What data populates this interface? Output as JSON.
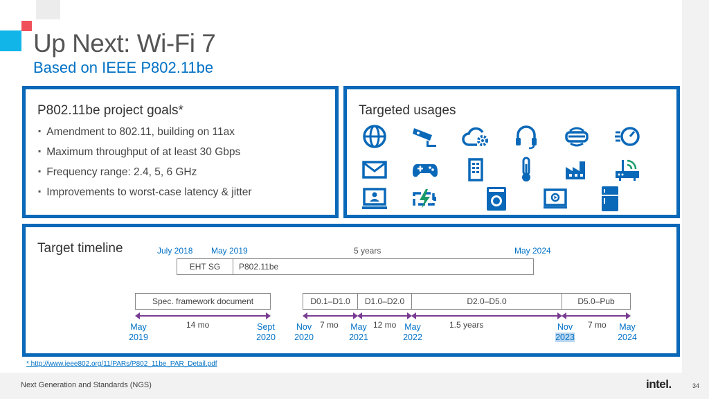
{
  "slide": {
    "title": "Up Next: Wi-Fi 7",
    "subtitle": "Based on IEEE P802.11be"
  },
  "goals": {
    "heading": "P802.11be project goals*",
    "items": [
      "Amendment to 802.11, building on 11ax",
      "Maximum throughput of at least 30 Gbps",
      "Frequency range: 2.4, 5, 6 GHz",
      "Improvements to worst-case latency & jitter"
    ]
  },
  "usages": {
    "heading": "Targeted usages",
    "icons": [
      "globe-icon",
      "security-camera-icon",
      "cloud-settings-icon",
      "headset-icon",
      "vr-headset-icon",
      "speedometer-icon",
      "mail-icon",
      "gamepad-icon",
      "smart-panel-icon",
      "thermometer-icon",
      "factory-icon",
      "router-icon",
      "video-call-icon",
      "battery-charging-icon",
      "washing-machine-icon",
      "monitor-play-icon",
      "refrigerator-icon"
    ]
  },
  "timeline": {
    "heading": "Target timeline",
    "top_labels": {
      "start": "July 2018",
      "mid": "May 2019",
      "span": "5 years",
      "end": "May 2024"
    },
    "top_bars": [
      "EHT SG",
      "P802.11be"
    ],
    "phases": [
      "Spec. framework document",
      "D0.1–D1.0",
      "D1.0–D2.0",
      "D2.0–D5.0",
      "D5.0–Pub"
    ],
    "durations": [
      "14 mo",
      "7 mo",
      "12 mo",
      "1.5 years",
      "7 mo"
    ],
    "dates": [
      {
        "m": "May",
        "y": "2019"
      },
      {
        "m": "Sept",
        "y": "2020"
      },
      {
        "m": "Nov",
        "y": "2020"
      },
      {
        "m": "May",
        "y": "2021"
      },
      {
        "m": "May",
        "y": "2022"
      },
      {
        "m": "Nov",
        "y": "2023"
      },
      {
        "m": "May",
        "y": "2024"
      }
    ]
  },
  "footnote": "* http://www.ieee802.org/11/PARs/P802_11be_PAR_Detail.pdf",
  "footer": {
    "text": "Next Generation and Standards (NGS)",
    "logo": "intel.",
    "page": "34"
  },
  "colors": {
    "accent": "#0a68b8",
    "text_blue": "#0071c5",
    "arrow": "#7a3c92",
    "red": "#f0505a",
    "cyan": "#12b5e8"
  }
}
